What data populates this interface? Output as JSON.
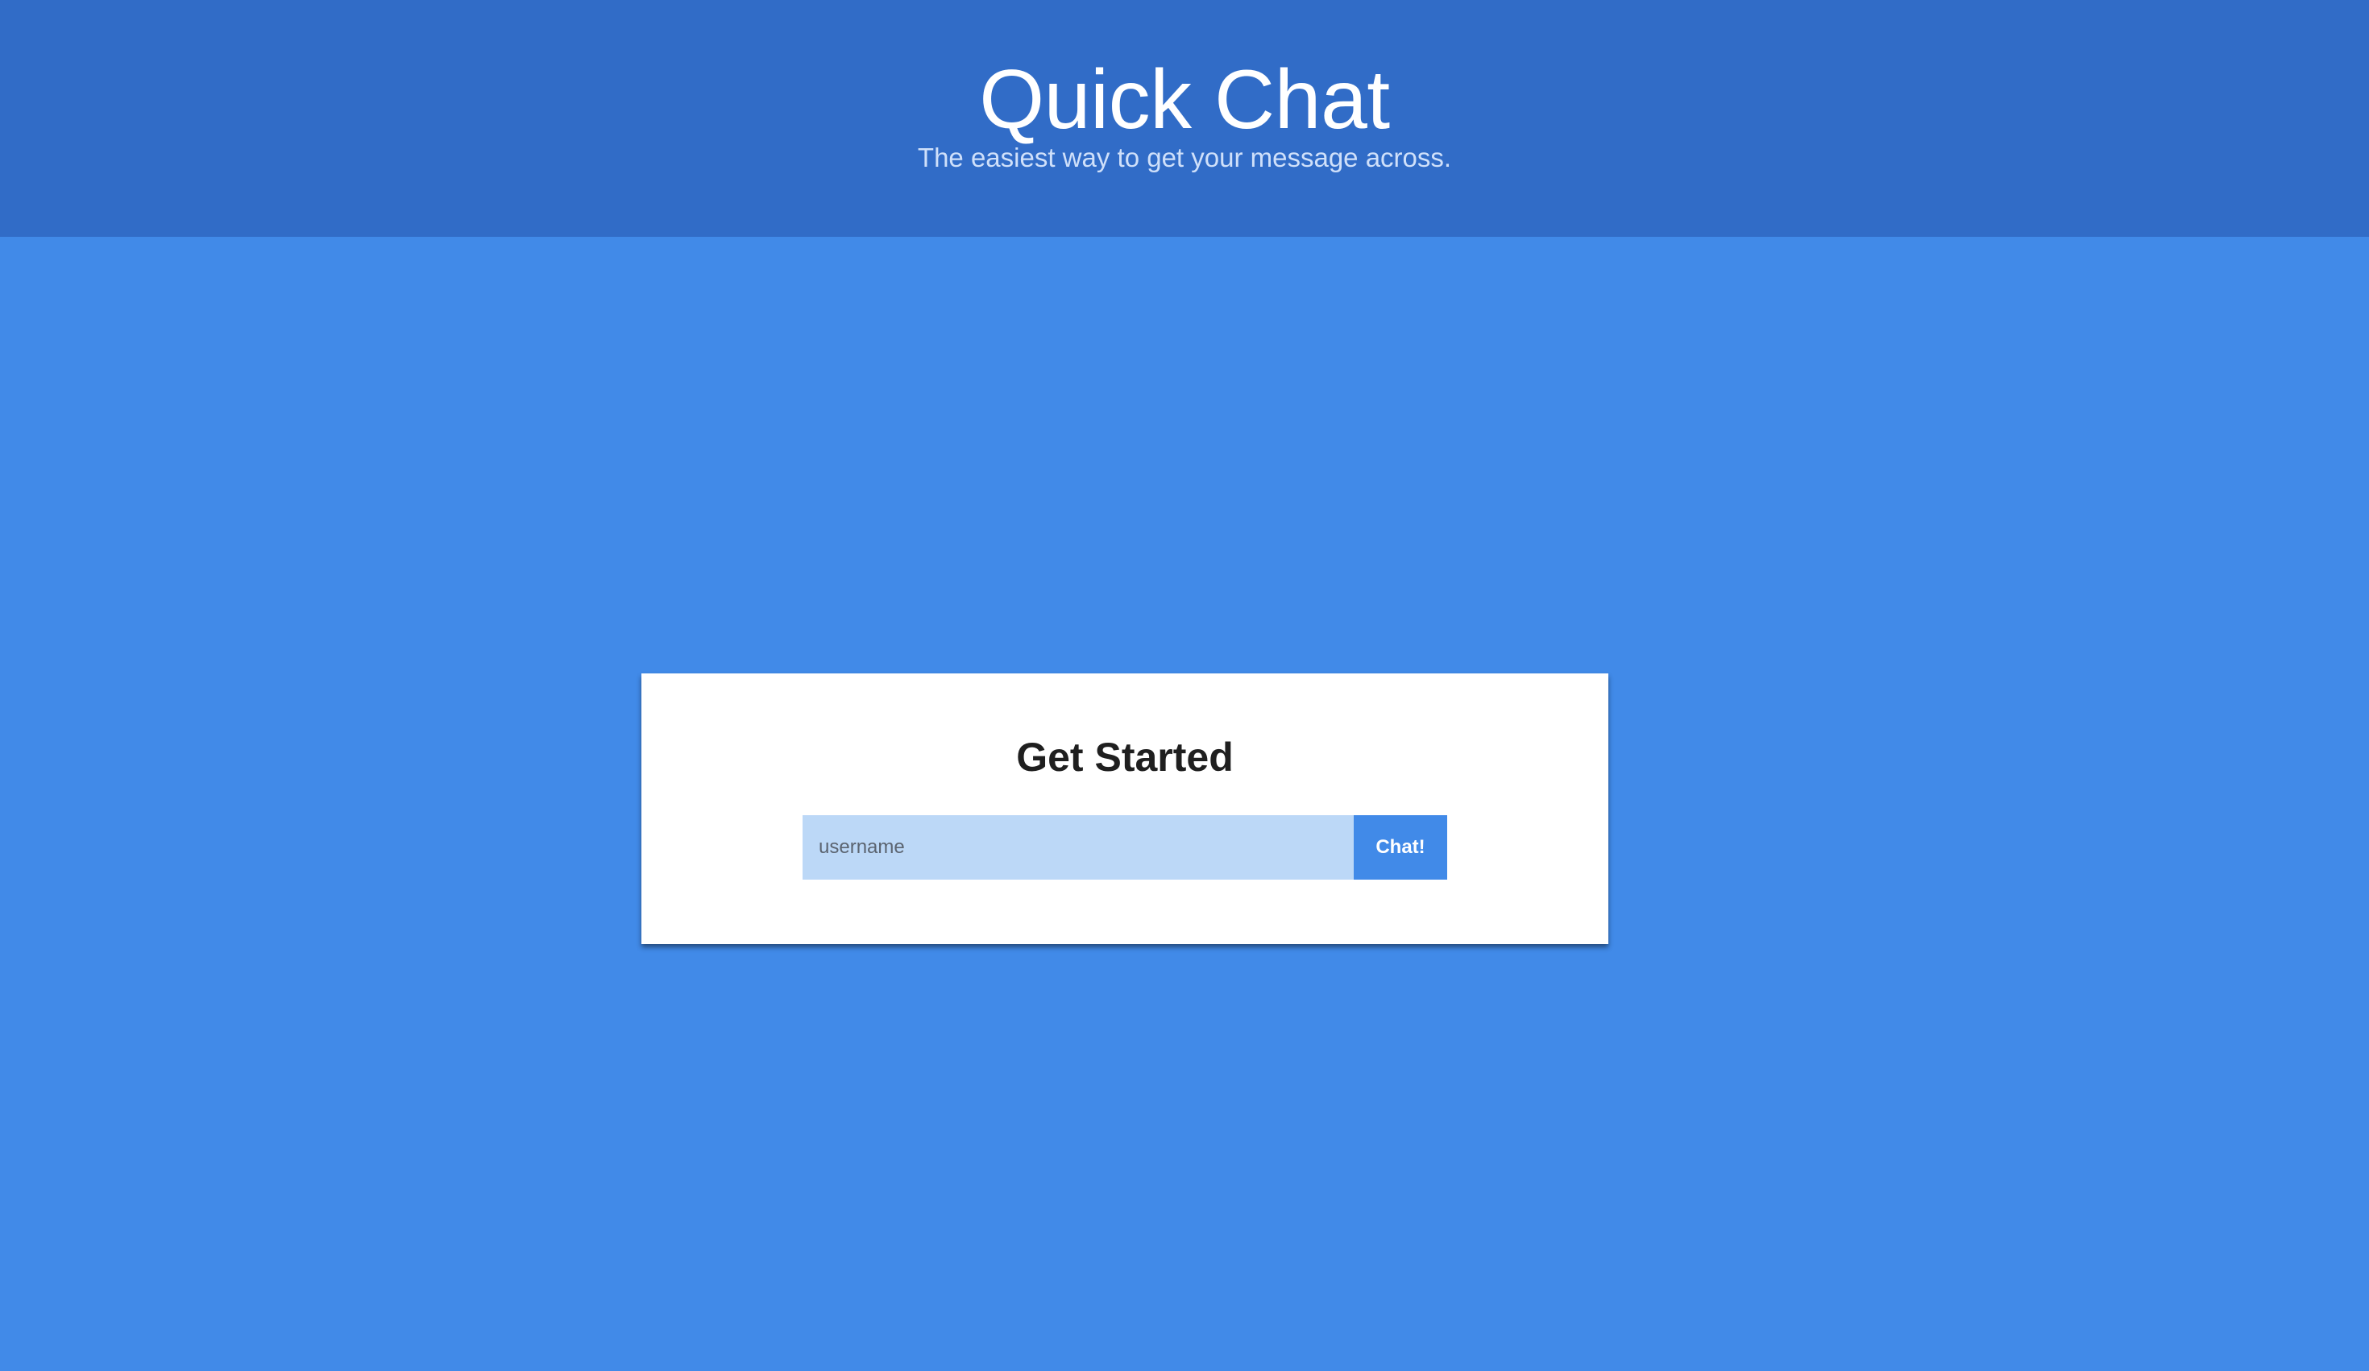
{
  "header": {
    "title": "Quick Chat",
    "subtitle": "The easiest way to get your message across."
  },
  "card": {
    "title": "Get Started",
    "username_input": {
      "value": "",
      "placeholder": "username"
    },
    "submit_label": "Chat!"
  },
  "colors": {
    "header_background": "#316cc7",
    "page_background": "#418ae8",
    "card_background": "#ffffff",
    "input_background": "#bcd8f7",
    "button_background": "#418ae8"
  }
}
